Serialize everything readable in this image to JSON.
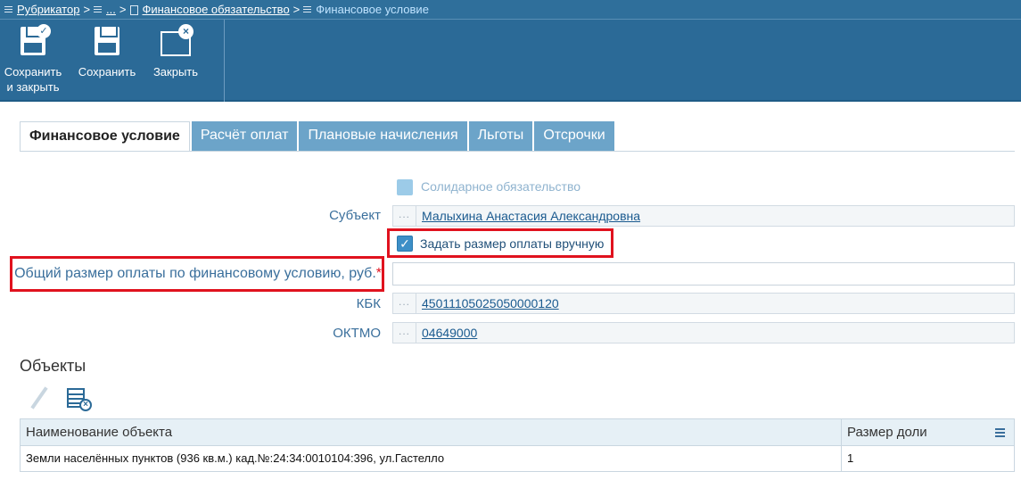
{
  "breadcrumb": {
    "items": [
      {
        "label": "Рубрикатор",
        "icon": "list-icon"
      },
      {
        "label": "...",
        "icon": "list-icon"
      },
      {
        "label": "Финансовое обязательство",
        "icon": "document-icon"
      },
      {
        "label": "Финансовое условие",
        "icon": "list-icon"
      }
    ],
    "separator": ">"
  },
  "toolbar": {
    "save_close_label_1": "Сохранить",
    "save_close_label_2": "и закрыть",
    "save_label": "Сохранить",
    "close_label": "Закрыть"
  },
  "tabs": [
    {
      "label": "Финансовое условие",
      "active": true
    },
    {
      "label": "Расчёт оплат",
      "active": false
    },
    {
      "label": "Плановые начисления",
      "active": false
    },
    {
      "label": "Льготы",
      "active": false
    },
    {
      "label": "Отсрочки",
      "active": false
    }
  ],
  "form": {
    "solidary_label": "Солидарное обязательство",
    "subject_label": "Субъект",
    "subject_value": "Малыхина Анастасия Александровна",
    "manual_payment_label": "Задать размер оплаты вручную",
    "total_payment_label": "Общий размер оплаты по финансовому условию, руб.",
    "required_mark": "*",
    "total_payment_value": "",
    "kbk_label": "КБК",
    "kbk_value": "45011105025050000120",
    "oktmo_label": "ОКТМО",
    "oktmo_value": "04649000",
    "lookup_dots": "..."
  },
  "objects": {
    "title": "Объекты",
    "columns": [
      "Наименование объекта",
      "Размер доли"
    ],
    "rows": [
      [
        "Земли населённых пунктов (936 кв.м.) кад.№:24:34:0010104:396, ул.Гастелло",
        "1"
      ]
    ]
  },
  "colors": {
    "accent": "#2b6a97",
    "highlight": "#e0121e",
    "label": "#3a6f9c"
  }
}
